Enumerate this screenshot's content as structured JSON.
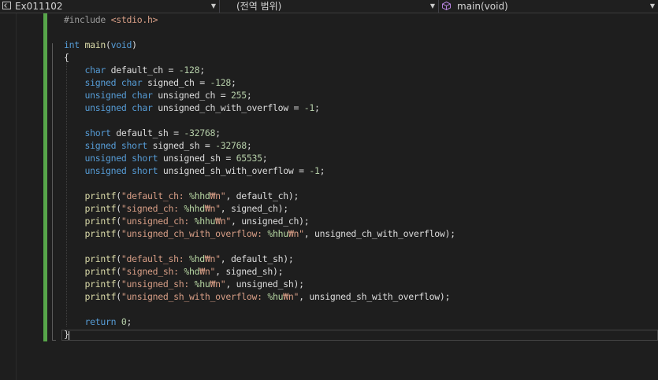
{
  "navbar": {
    "project": "Ex011102",
    "scope": "(전역 범위)",
    "function": "main(void)"
  },
  "colors": {
    "background": "#1e1e1e",
    "keyword": "#569cd6",
    "function": "#dcdcaa",
    "string": "#d69d85",
    "change_bar": "#57a64a"
  },
  "icons": {
    "project": "project-icon",
    "function": "cube-icon"
  },
  "code": {
    "lines": [
      [
        {
          "t": "#include ",
          "c": "pp"
        },
        {
          "t": "<stdio.h>",
          "c": "inc"
        }
      ],
      [],
      [
        {
          "t": "int",
          "c": "kw"
        },
        {
          "t": " "
        },
        {
          "t": "main",
          "c": "fn"
        },
        {
          "t": "("
        },
        {
          "t": "void",
          "c": "kw"
        },
        {
          "t": ")"
        }
      ],
      [
        {
          "t": "{"
        }
      ],
      [
        {
          "t": "    "
        },
        {
          "t": "char",
          "c": "kw"
        },
        {
          "t": " default_ch = "
        },
        {
          "t": "-128",
          "c": "num"
        },
        {
          "t": ";"
        }
      ],
      [
        {
          "t": "    "
        },
        {
          "t": "signed char",
          "c": "kw"
        },
        {
          "t": " signed_ch = "
        },
        {
          "t": "-128",
          "c": "num"
        },
        {
          "t": ";"
        }
      ],
      [
        {
          "t": "    "
        },
        {
          "t": "unsigned char",
          "c": "kw"
        },
        {
          "t": " unsigned_ch = "
        },
        {
          "t": "255",
          "c": "num"
        },
        {
          "t": ";"
        }
      ],
      [
        {
          "t": "    "
        },
        {
          "t": "unsigned char",
          "c": "kw"
        },
        {
          "t": " unsigned_ch_with_overflow = "
        },
        {
          "t": "-1",
          "c": "num"
        },
        {
          "t": ";"
        }
      ],
      [],
      [
        {
          "t": "    "
        },
        {
          "t": "short",
          "c": "kw"
        },
        {
          "t": " default_sh = "
        },
        {
          "t": "-32768",
          "c": "num"
        },
        {
          "t": ";"
        }
      ],
      [
        {
          "t": "    "
        },
        {
          "t": "signed short",
          "c": "kw"
        },
        {
          "t": " signed_sh = "
        },
        {
          "t": "-32768",
          "c": "num"
        },
        {
          "t": ";"
        }
      ],
      [
        {
          "t": "    "
        },
        {
          "t": "unsigned short",
          "c": "kw"
        },
        {
          "t": " unsigned_sh = "
        },
        {
          "t": "65535",
          "c": "num"
        },
        {
          "t": ";"
        }
      ],
      [
        {
          "t": "    "
        },
        {
          "t": "unsigned short",
          "c": "kw"
        },
        {
          "t": " unsigned_sh_with_overflow = "
        },
        {
          "t": "-1",
          "c": "num"
        },
        {
          "t": ";"
        }
      ],
      [],
      [
        {
          "t": "    "
        },
        {
          "t": "printf",
          "c": "fn"
        },
        {
          "t": "("
        },
        {
          "t": "\"default_ch: ",
          "c": "str"
        },
        {
          "t": "%hhd",
          "c": "fmt"
        },
        {
          "t": "₩n\"",
          "c": "str"
        },
        {
          "t": ", default_ch);"
        }
      ],
      [
        {
          "t": "    "
        },
        {
          "t": "printf",
          "c": "fn"
        },
        {
          "t": "("
        },
        {
          "t": "\"signed_ch: ",
          "c": "str"
        },
        {
          "t": "%hhd",
          "c": "fmt"
        },
        {
          "t": "₩n\"",
          "c": "str"
        },
        {
          "t": ", signed_ch);"
        }
      ],
      [
        {
          "t": "    "
        },
        {
          "t": "printf",
          "c": "fn"
        },
        {
          "t": "("
        },
        {
          "t": "\"unsigned_ch: ",
          "c": "str"
        },
        {
          "t": "%hhu",
          "c": "fmt"
        },
        {
          "t": "₩n\"",
          "c": "str"
        },
        {
          "t": ", unsigned_ch);"
        }
      ],
      [
        {
          "t": "    "
        },
        {
          "t": "printf",
          "c": "fn"
        },
        {
          "t": "("
        },
        {
          "t": "\"unsigned_ch_with_overflow: ",
          "c": "str"
        },
        {
          "t": "%hhu",
          "c": "fmt"
        },
        {
          "t": "₩n\"",
          "c": "str"
        },
        {
          "t": ", unsigned_ch_with_overflow);"
        }
      ],
      [],
      [
        {
          "t": "    "
        },
        {
          "t": "printf",
          "c": "fn"
        },
        {
          "t": "("
        },
        {
          "t": "\"default_sh: ",
          "c": "str"
        },
        {
          "t": "%hd",
          "c": "fmt"
        },
        {
          "t": "₩n\"",
          "c": "str"
        },
        {
          "t": ", default_sh);"
        }
      ],
      [
        {
          "t": "    "
        },
        {
          "t": "printf",
          "c": "fn"
        },
        {
          "t": "("
        },
        {
          "t": "\"signed_sh: ",
          "c": "str"
        },
        {
          "t": "%hd",
          "c": "fmt"
        },
        {
          "t": "₩n\"",
          "c": "str"
        },
        {
          "t": ", signed_sh);"
        }
      ],
      [
        {
          "t": "    "
        },
        {
          "t": "printf",
          "c": "fn"
        },
        {
          "t": "("
        },
        {
          "t": "\"unsigned_sh: ",
          "c": "str"
        },
        {
          "t": "%hu",
          "c": "fmt"
        },
        {
          "t": "₩n\"",
          "c": "str"
        },
        {
          "t": ", unsigned_sh);"
        }
      ],
      [
        {
          "t": "    "
        },
        {
          "t": "printf",
          "c": "fn"
        },
        {
          "t": "("
        },
        {
          "t": "\"unsigned_sh_with_overflow: ",
          "c": "str"
        },
        {
          "t": "%hu",
          "c": "fmt"
        },
        {
          "t": "₩n\"",
          "c": "str"
        },
        {
          "t": ", unsigned_sh_with_overflow);"
        }
      ],
      [],
      [
        {
          "t": "    "
        },
        {
          "t": "return",
          "c": "kw"
        },
        {
          "t": " "
        },
        {
          "t": "0",
          "c": "num"
        },
        {
          "t": ";"
        }
      ],
      [
        {
          "t": "}"
        }
      ]
    ]
  }
}
